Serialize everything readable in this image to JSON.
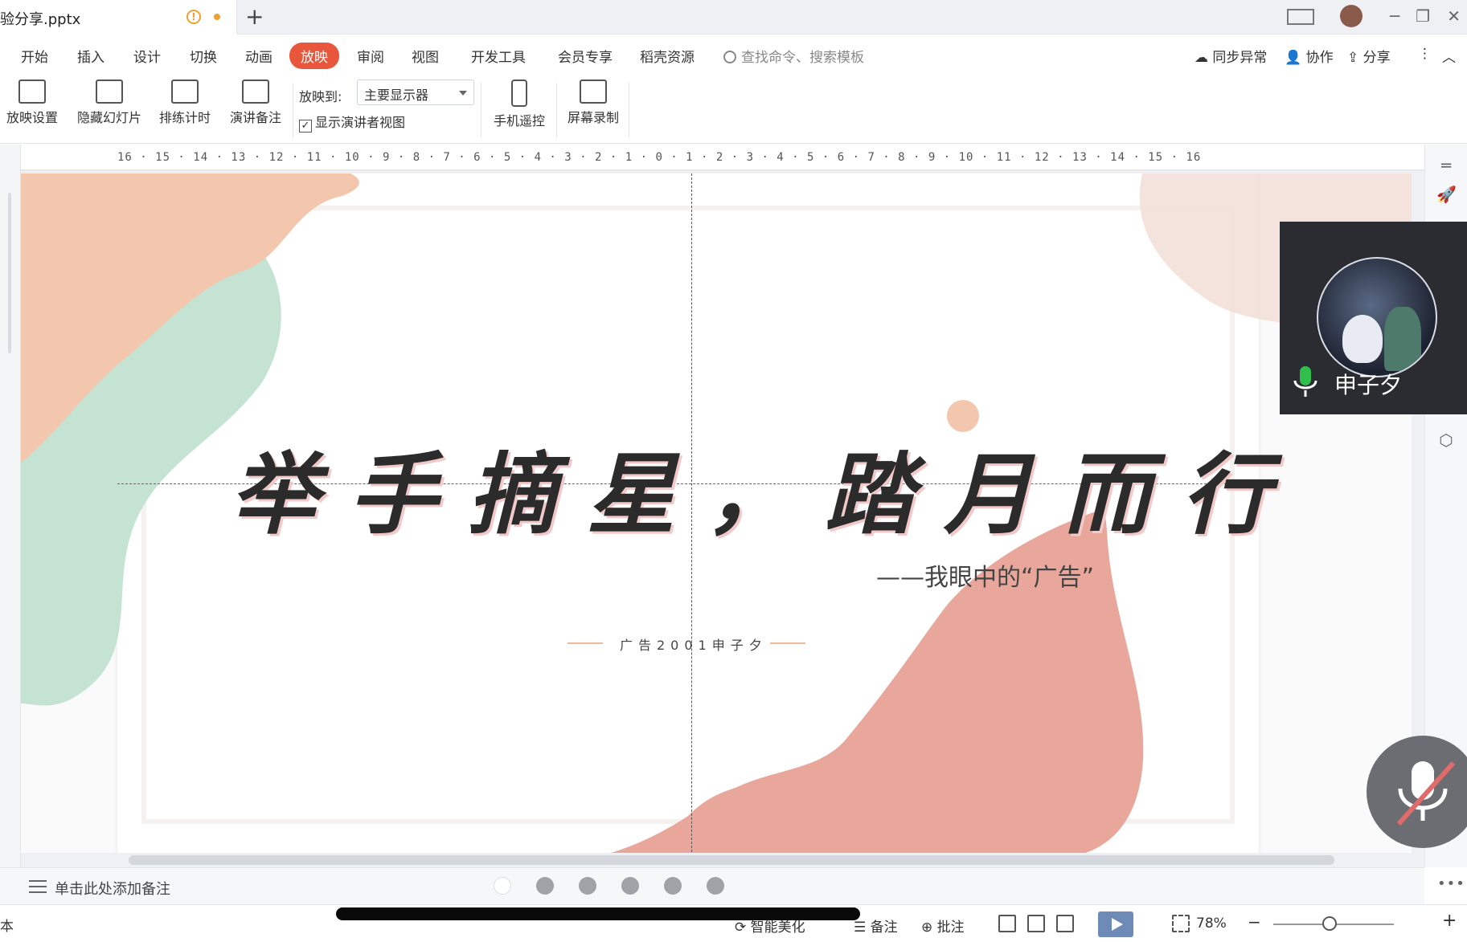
{
  "window": {
    "doc_title": "验分享.pptx",
    "new_tab": "+",
    "controls": [
      "─",
      "❐",
      "✕"
    ]
  },
  "menu": {
    "items": [
      "开始",
      "插入",
      "设计",
      "切换",
      "动画",
      "放映",
      "审阅",
      "视图",
      "开发工具",
      "会员专享",
      "稻壳资源"
    ],
    "active": "放映",
    "search_placeholder": "查找命令、搜索模板",
    "sync": "同步异常",
    "collab": "协作",
    "share": "分享",
    "more": "⋮",
    "collapse": "︿"
  },
  "ribbon": {
    "buttons": [
      {
        "label": "放映设置",
        "icon": "slideshow-settings-icon"
      },
      {
        "label": "隐藏幻灯片",
        "icon": "hide-slide-icon"
      },
      {
        "label": "排练计时",
        "icon": "rehearse-timing-icon"
      },
      {
        "label": "演讲备注",
        "icon": "speaker-notes-icon"
      }
    ],
    "cast_to_label": "放映到:",
    "cast_to_value": "主要显示器",
    "presenter_view_label": "显示演讲者视图",
    "presenter_view_checked": true,
    "remote_label": "手机遥控",
    "record_label": "屏幕录制"
  },
  "ruler": {
    "ticks": "16 · 15 · 14 · 13 · 12 · 11 · 10 · 9 · 8 · 7 · 6 · 5 · 4 · 3 · 2 · 1 · 0 · 1 · 2 · 3 · 4 · 5 · 6 · 7 · 8 · 9 · 10 · 11 · 12 · 13 · 14 · 15 · 16"
  },
  "slide": {
    "title": "举手摘星，踏月而行",
    "subtitle": "——我眼中的“广告”",
    "credit": "广告2001申子夕",
    "colors": {
      "peach": "#f3c7ae",
      "mint": "#c5e3d3",
      "coral": "#e9a79c",
      "blush": "#f2e0d8"
    }
  },
  "call": {
    "name": "申子夕",
    "mic_color": "#2fbf4a"
  },
  "notes": {
    "placeholder": "单击此处添加备注",
    "page_count": 6,
    "current_page": 1,
    "more": "•••"
  },
  "status": {
    "left_text": "本",
    "smart_beautify": "智能美化",
    "notes": "备注",
    "comments": "批注",
    "zoom": "78%",
    "zoom_minus": "−",
    "zoom_plus": "+"
  }
}
